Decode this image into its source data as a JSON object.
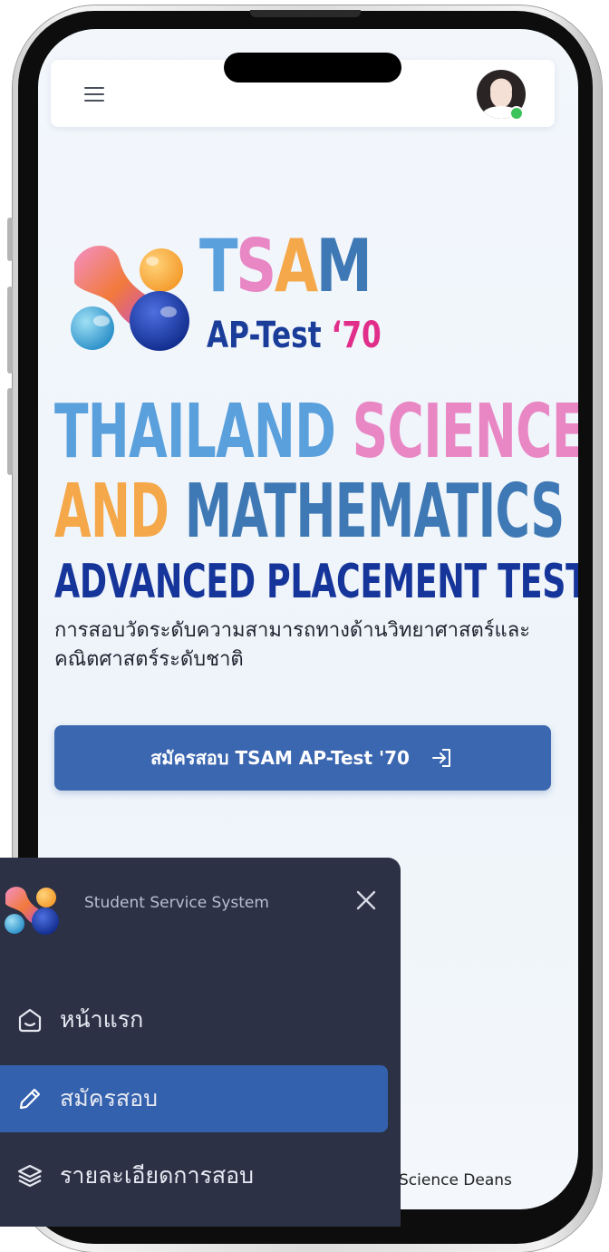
{
  "header": {
    "menu_label": "menu",
    "avatar_status": "online"
  },
  "hero": {
    "logo_title_parts": [
      "T",
      "S",
      "A",
      "M"
    ],
    "logo_subtitle": "AP-Test",
    "logo_year": "‘70",
    "headline_line1_a": "THAILAND",
    "headline_line1_b": "SCIENCE",
    "headline_line2_a": "AND",
    "headline_line2_b": "MATHEMATICS",
    "headline_line3": "ADVANCED PLACEMENT TEST",
    "description": "การสอบวัดระดับความสามารถทางด้านวิทยาศาสตร์และคณิตศาสตร์ระดับชาติ",
    "register_label": "สมัครสอบ TSAM AP-Test '70"
  },
  "footer": {
    "partial_text": "Science Deans"
  },
  "drawer": {
    "title": "Student Service System",
    "items": [
      {
        "label": "หน้าแรก",
        "icon": "home-icon"
      },
      {
        "label": "สมัครสอบ",
        "icon": "pencil-icon",
        "active": true
      },
      {
        "label": "รายละเอียดการสอบ",
        "icon": "layers-icon"
      }
    ]
  },
  "colors": {
    "accent": "#3b66b0",
    "drawer_bg": "#2c3145",
    "logo_blue": "#5aa0dc",
    "logo_pink": "#e887c4",
    "logo_orange": "#f4a84a",
    "logo_navy": "#16359a"
  }
}
